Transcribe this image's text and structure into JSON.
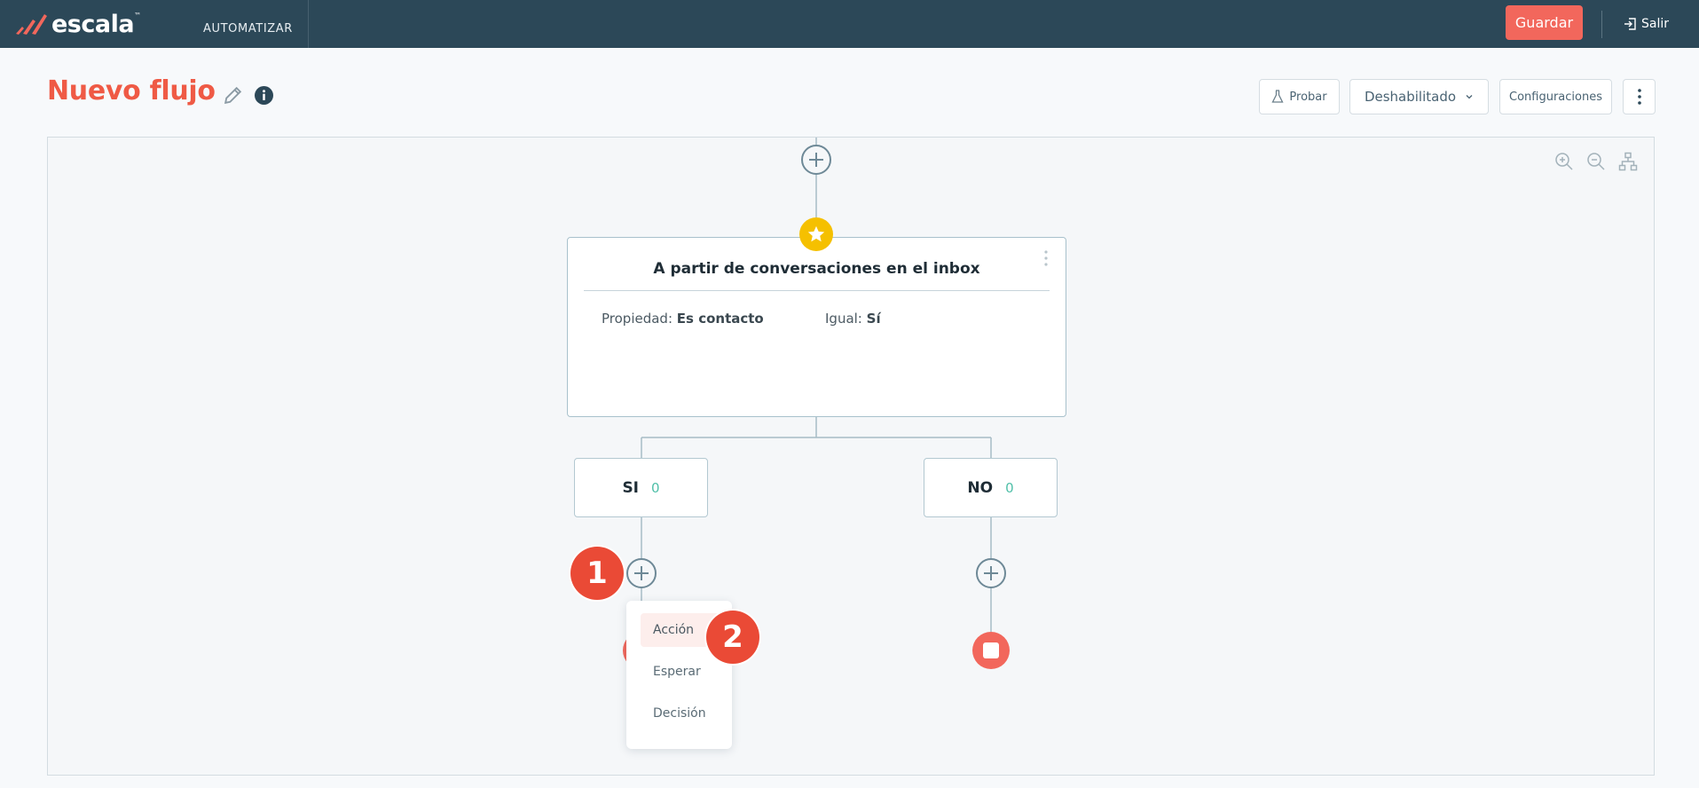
{
  "topbar": {
    "logo_text": "escala",
    "logo_tm": "™",
    "nav_label": "AUTOMATIZAR",
    "save_label": "Guardar",
    "logout_label": "Salir"
  },
  "header": {
    "title": "Nuevo flujo",
    "test_label": "Probar",
    "status_label": "Deshabilitado",
    "config_label": "Configuraciones"
  },
  "flow": {
    "trigger": {
      "title": "A partir de conversaciones en el inbox",
      "property_label": "Propiedad:",
      "property_value": "Es contacto",
      "equals_label": "Igual:",
      "equals_value": "Sí"
    },
    "branches": [
      {
        "label": "SI",
        "count": "0"
      },
      {
        "label": "NO",
        "count": "0"
      }
    ]
  },
  "menu": {
    "items": [
      "Acción",
      "Esperar",
      "Decisión"
    ],
    "selected": "Acción"
  },
  "badges": [
    "1",
    "2"
  ],
  "colors": {
    "topbar": "#2c4858",
    "accent": "#f2675c",
    "title": "#ef5a45",
    "star": "#f5c000",
    "count": "#4fbfa8"
  }
}
